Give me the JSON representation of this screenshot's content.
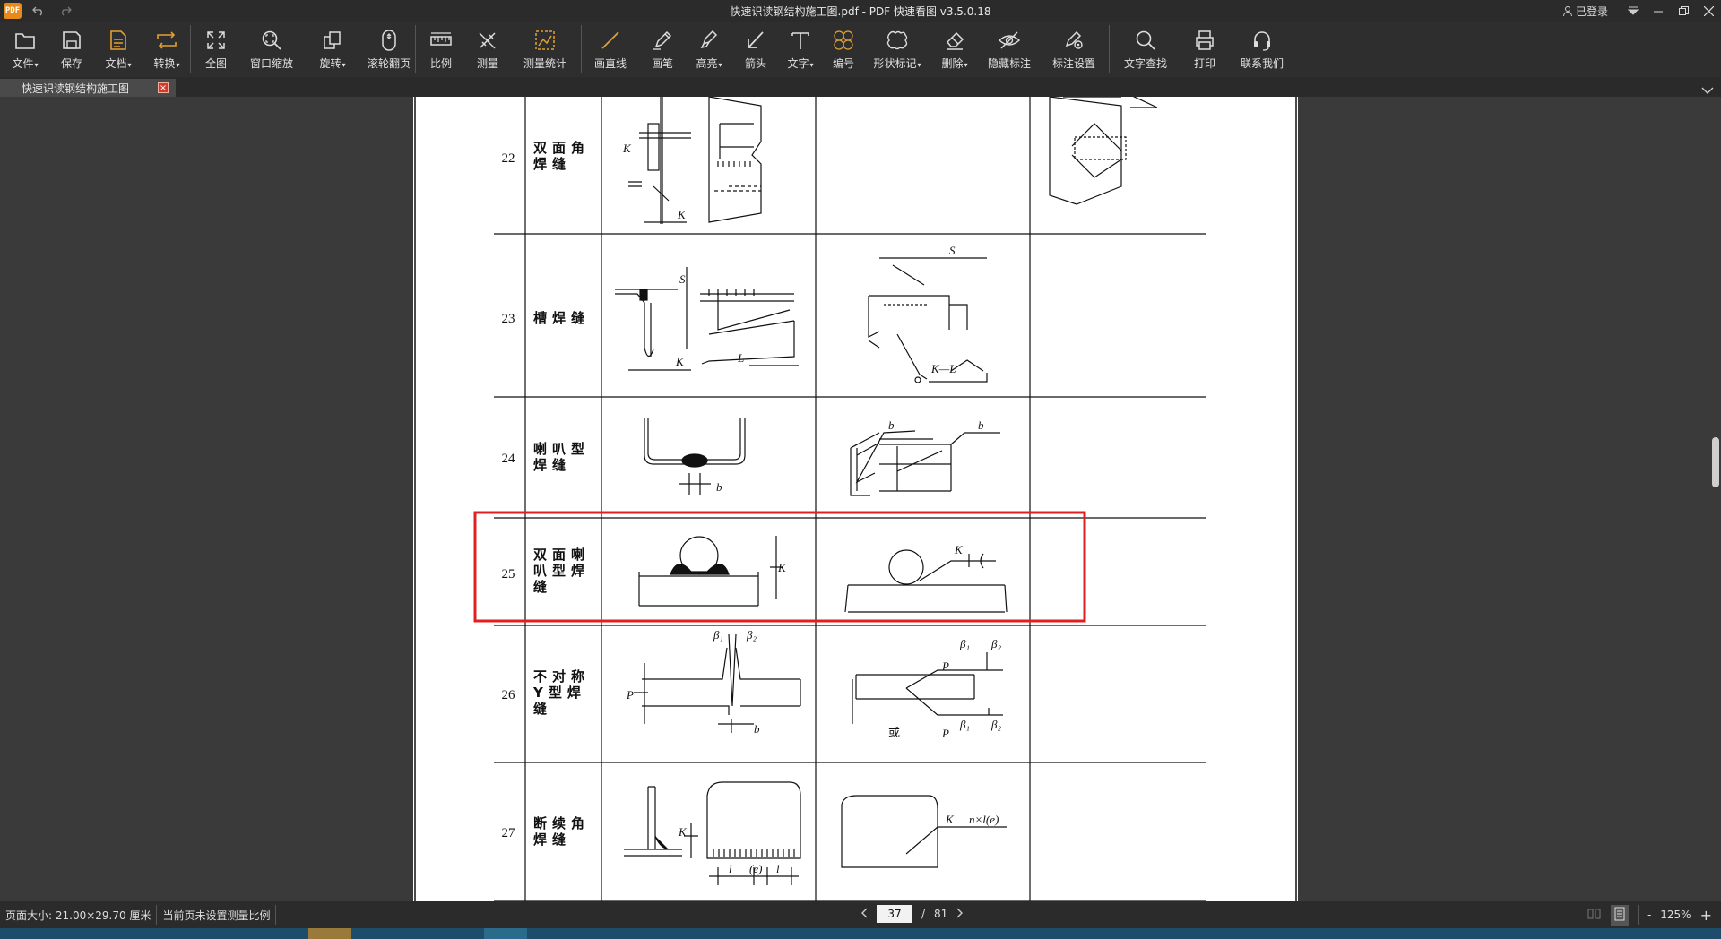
{
  "window": {
    "title": "快速识读钢结构施工图.pdf - PDF 快速看图 v3.5.0.18",
    "logo_text": "PDF",
    "login_label": "已登录"
  },
  "toolbar": {
    "file": "文件",
    "save": "保存",
    "doc": "文档",
    "convert": "转换",
    "fit_all": "全图",
    "window_zoom": "窗口缩放",
    "rotate": "旋转",
    "scroll_page": "滚轮翻页",
    "scale": "比例",
    "measure": "测量",
    "measure_stats": "测量统计",
    "line": "画直线",
    "pen": "画笔",
    "highlight": "高亮",
    "arrow": "箭头",
    "text": "文字",
    "number": "编号",
    "shape_mark": "形状标记",
    "delete": "删除",
    "hide_marks": "隐藏标注",
    "mark_settings": "标注设置",
    "text_search": "文字查找",
    "print": "打印",
    "contact": "联系我们"
  },
  "tab": {
    "label": "快速识读钢结构施工图",
    "close": "×"
  },
  "table": {
    "rows": [
      {
        "no": "22",
        "name": "双面角\n焊缝"
      },
      {
        "no": "23",
        "name": "槽焊缝"
      },
      {
        "no": "24",
        "name": "喇叭型\n焊缝"
      },
      {
        "no": "25",
        "name": "双面喇\n叭型焊\n缝"
      },
      {
        "no": "26",
        "name": "不对称\nY型焊\n缝"
      },
      {
        "no": "27",
        "name": "断续角\n焊缝"
      }
    ],
    "labels": {
      "K": "K",
      "S": "S",
      "L": "L",
      "b": "b",
      "P": "P",
      "l": "l",
      "e": "(e)",
      "KL": "K—L",
      "or": "或",
      "b1": "β₁",
      "b2": "β₂",
      "nle": "n×l(e)"
    }
  },
  "status": {
    "page_size": "页面大小: 21.00×29.70 厘米",
    "scale_note": "当前页未设置测量比例",
    "current_page": "37",
    "page_sep": "/",
    "total_pages": "81",
    "zoom_minus": "-",
    "zoom_level": "125%",
    "zoom_plus": "+"
  },
  "colors": {
    "highlight_box": "#e02020",
    "accent": "#e0a030"
  }
}
